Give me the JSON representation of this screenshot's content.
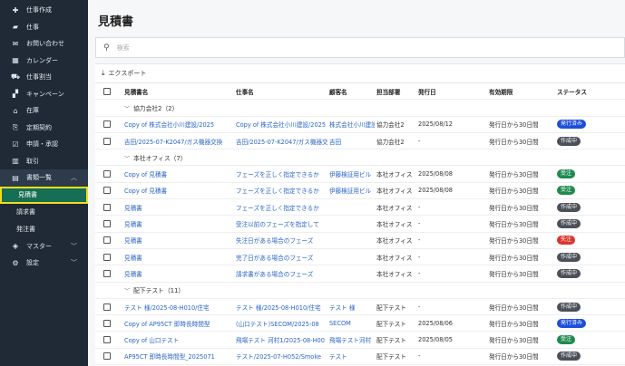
{
  "sidebar": {
    "items": [
      {
        "icon": "job-create-icon",
        "label": "仕事作成"
      },
      {
        "icon": "briefcase-icon",
        "label": "仕事"
      },
      {
        "icon": "mail-icon",
        "label": "お問い合わせ"
      },
      {
        "icon": "calendar-icon",
        "label": "カレンダー"
      },
      {
        "icon": "truck-icon",
        "label": "仕事割当"
      },
      {
        "icon": "campaign-icon",
        "label": "キャンペーン"
      },
      {
        "icon": "warehouse-icon",
        "label": "在庫"
      },
      {
        "icon": "contract-icon",
        "label": "定期契約"
      },
      {
        "icon": "approval-icon",
        "label": "申請・承認"
      },
      {
        "icon": "calculator-icon",
        "label": "取引"
      }
    ],
    "documents": {
      "icon": "document-icon",
      "label": "書類一覧"
    },
    "sub_items": [
      "見積書",
      "請求書",
      "発注書"
    ],
    "master": {
      "icon": "master-icon",
      "label": "マスター"
    },
    "settings": {
      "icon": "gear-icon",
      "label": "設定"
    }
  },
  "main": {
    "title": "見積書",
    "search_placeholder": "検索",
    "export_label": "エクスポート",
    "columns": [
      "見積書名",
      "仕事名",
      "顧客名",
      "担当部署",
      "発行日",
      "有効期限",
      "ステータス"
    ],
    "groups": [
      {
        "label": "協力会社2（2）",
        "rows": [
          {
            "name": "Copy of 株式会社小川建設/2025",
            "job": "Copy of 株式会社小川建設/2025",
            "customer": "株式会社小川建設",
            "dept": "協力会社2",
            "issued": "2025/08/12",
            "valid": "発行日から30日間",
            "status": "発行済み",
            "status_color": "#1e4fd8"
          },
          {
            "name": "吉田/2025-07-K2047/ガス機器交換",
            "job": "吉田/2025-07-K2047/ガス機器交換",
            "customer": "吉田",
            "dept": "協力会社2",
            "issued": "-",
            "valid": "発行日から30日間",
            "status": "作成中",
            "status_color": "#4b5058"
          }
        ]
      },
      {
        "label": "本社オフィス（7）",
        "rows": [
          {
            "name": "Copy of 見積書",
            "job": "フェーズを正しく指定できるか",
            "customer": "伊藤検証用ビル",
            "dept": "本社オフィス",
            "issued": "2025/08/08",
            "valid": "発行日から30日間",
            "status": "受注",
            "status_color": "#1e8a4f"
          },
          {
            "name": "Copy of 見積書",
            "job": "フェーズを正しく指定できるか",
            "customer": "伊藤検証用ビル",
            "dept": "本社オフィス",
            "issued": "2025/08/08",
            "valid": "発行日から30日間",
            "status": "受注",
            "status_color": "#1e8a4f"
          },
          {
            "name": "見積書",
            "job": "フェーズを正しく指定できるか",
            "customer": "",
            "dept": "本社オフィス",
            "issued": "-",
            "valid": "発行日から30日間",
            "status": "作成中",
            "status_color": "#4b5058"
          },
          {
            "name": "見積書",
            "job": "受注以前のフェーズを指定して",
            "customer": "",
            "dept": "本社オフィス",
            "issued": "-",
            "valid": "発行日から30日間",
            "status": "作成中",
            "status_color": "#4b5058"
          },
          {
            "name": "見積書",
            "job": "失注日がある場合のフェーズ",
            "customer": "",
            "dept": "本社オフィス",
            "issued": "-",
            "valid": "発行日から30日間",
            "status": "失注",
            "status_color": "#d9362b"
          },
          {
            "name": "見積書",
            "job": "完了日がある場合のフェーズ",
            "customer": "",
            "dept": "本社オフィス",
            "issued": "-",
            "valid": "発行日から30日間",
            "status": "作成中",
            "status_color": "#4b5058"
          },
          {
            "name": "見積書",
            "job": "請求書がある場合のフェーズ",
            "customer": "",
            "dept": "本社オフィス",
            "issued": "-",
            "valid": "発行日から30日間",
            "status": "作成中",
            "status_color": "#4b5058"
          }
        ]
      },
      {
        "label": "配下テスト（11）",
        "rows": [
          {
            "name": "テスト 様/2025-08-H010/住宅",
            "job": "テスト 様/2025-08-H010/住宅",
            "customer": "テスト 様",
            "dept": "配下テスト",
            "issued": "-",
            "valid": "発行日から30日間",
            "status": "作成中",
            "status_color": "#4b5058"
          },
          {
            "name": "Copy of AP95CT 即時長時間型",
            "job": "(山口テスト)SECOM/2025-08",
            "customer": "SECOM",
            "dept": "配下テスト",
            "issued": "2025/08/06",
            "valid": "発行日から30日間",
            "status": "発行済み",
            "status_color": "#1e4fd8"
          },
          {
            "name": "Copy of 山口テスト",
            "job": "飛場テスト 河村1/2025-08-H00",
            "customer": "飛場テスト河村",
            "dept": "配下テスト",
            "issued": "2025/08/05",
            "valid": "発行日から30日間",
            "status": "受注",
            "status_color": "#1e8a4f"
          },
          {
            "name": "AP95CT 即時長時間型_2025071",
            "job": "テスト/2025-07-H052/Smoke",
            "customer": "テスト",
            "dept": "配下テスト",
            "issued": "-",
            "valid": "発行日から30日間",
            "status": "作成中",
            "status_color": "#4b5058"
          }
        ]
      }
    ]
  }
}
